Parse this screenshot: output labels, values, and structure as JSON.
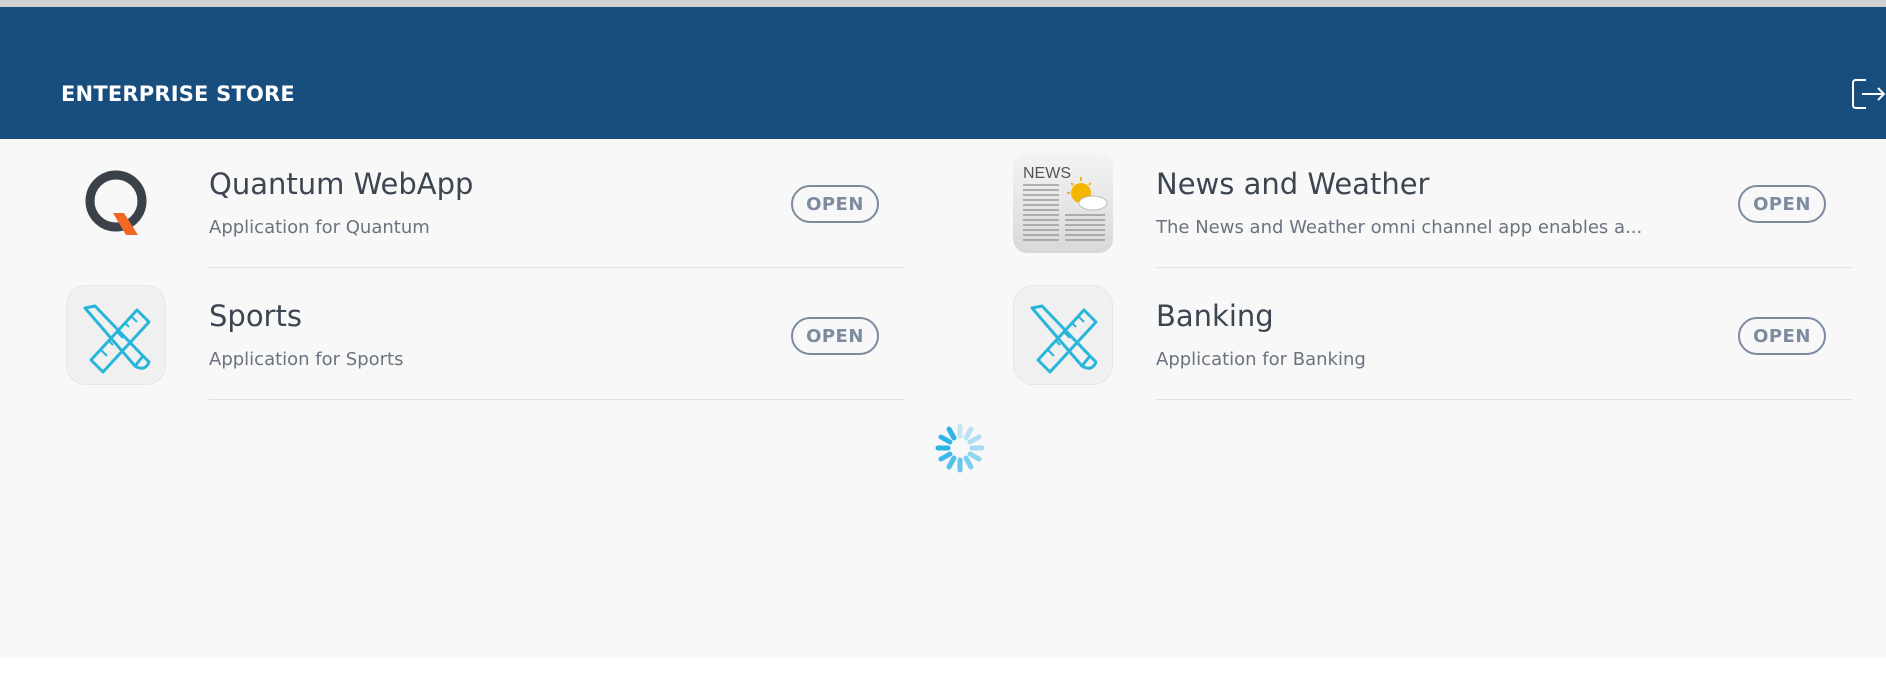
{
  "header": {
    "title": "ENTERPRISE STORE",
    "logout_icon": "logout-icon",
    "background": "#174e7e"
  },
  "apps": [
    {
      "name": "Quantum WebApp",
      "description": "Application for Quantum",
      "icon": "quantum-logo",
      "open_label": "OPEN"
    },
    {
      "name": "News and Weather",
      "description": "The News and Weather omni channel app enables a...",
      "icon": "news-weather-icon",
      "open_label": "OPEN"
    },
    {
      "name": "Sports",
      "description": "Application for Sports",
      "icon": "design-tools-icon",
      "open_label": "OPEN"
    },
    {
      "name": "Banking",
      "description": "Application for Banking",
      "icon": "design-tools-icon",
      "open_label": "OPEN"
    }
  ],
  "loading": {
    "icon": "loading-spinner",
    "color": "#2bb3ea"
  }
}
